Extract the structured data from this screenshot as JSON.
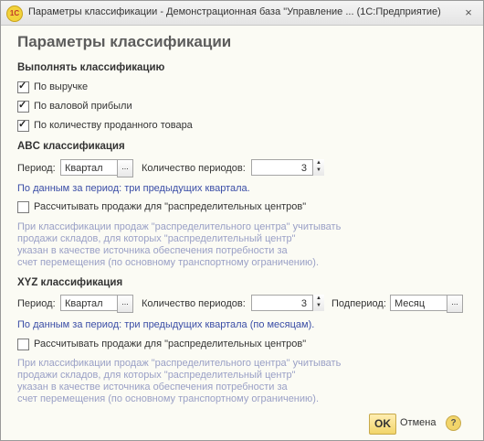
{
  "window": {
    "title": "Параметры классификации - Демонстрационная база \"Управление ...  (1С:Предприятие)",
    "logo_text": "1С",
    "close_glyph": "×"
  },
  "form_title": "Параметры классификации",
  "classify": {
    "heading": "Выполнять классификацию",
    "options": [
      {
        "label": "По выручке",
        "checked": true
      },
      {
        "label": "По валовой прибыли",
        "checked": true
      },
      {
        "label": "По количеству проданного товара",
        "checked": true
      }
    ]
  },
  "abc": {
    "heading": "ABC классификация",
    "period_label": "Период:",
    "period_value": "Квартал",
    "count_label": "Количество периодов:",
    "count_value": "3",
    "info": "По данным за период: три предыдущих квартала.",
    "dc_label": "Рассчитывать продажи для \"распределительных центров\"",
    "dc_checked": false,
    "hint": [
      "При классификации продаж \"распределительного центра\" учитывать",
      "продажи складов, для которых \"распределительный центр\"",
      "указан в качестве источника обеспечения потребности за",
      "счет перемещения (по основному транспортному ограничению)."
    ]
  },
  "xyz": {
    "heading": "XYZ классификация",
    "period_label": "Период:",
    "period_value": "Квартал",
    "count_label": "Количество периодов:",
    "count_value": "3",
    "subperiod_label": "Подпериод:",
    "subperiod_value": "Месяц",
    "info": "По данным за период: три предыдущих квартала (по месяцам).",
    "dc_label": "Рассчитывать продажи для \"распределительных центров\"",
    "dc_checked": false,
    "hint": [
      "При классификации продаж \"распределительного центра\" учитывать",
      "продажи складов, для которых \"распределительный центр\"",
      "указан в качестве источника обеспечения потребности за",
      "счет перемещения (по основному транспортному ограничению)."
    ]
  },
  "buttons": {
    "ok": "OK",
    "cancel": "Отмена",
    "help": "?"
  },
  "glyphs": {
    "select": "...",
    "spin_up": "▲",
    "spin_down": "▼"
  }
}
